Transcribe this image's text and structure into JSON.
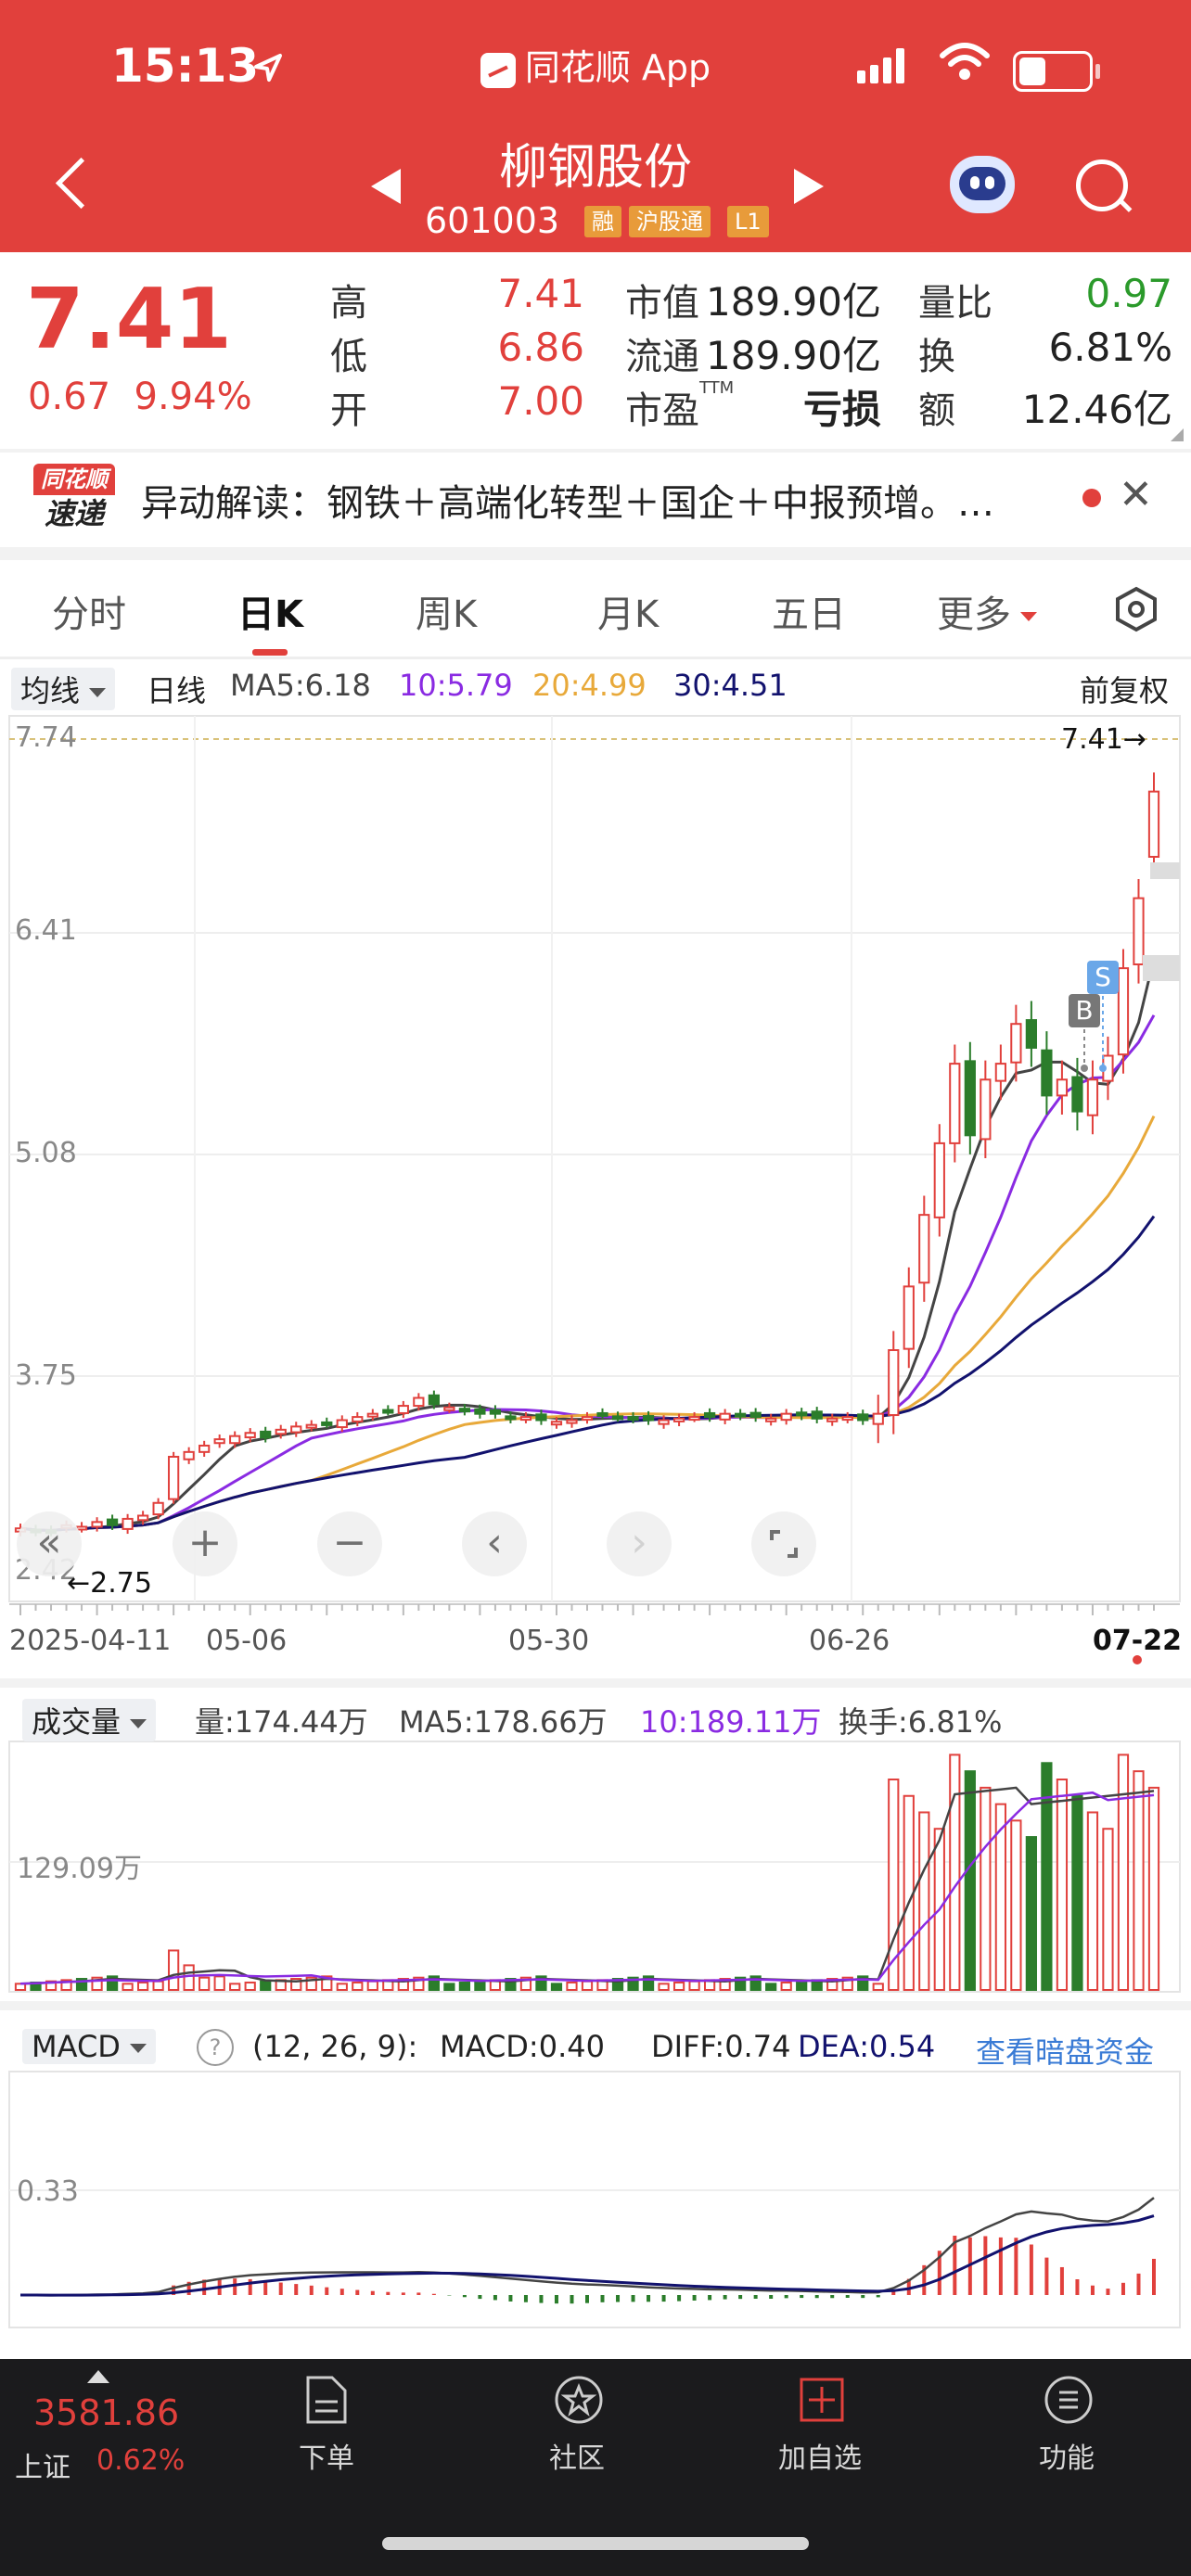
{
  "status_bar": {
    "time": "15:13",
    "app_title": "同花顺 App"
  },
  "header": {
    "stock_name": "柳钢股份",
    "stock_code": "601003",
    "tags": [
      "融",
      "沪股通",
      "L1"
    ]
  },
  "quote": {
    "price": "7.41",
    "change": "0.67",
    "change_pct": "9.94%",
    "high_label": "高",
    "high": "7.41",
    "low_label": "低",
    "low": "6.86",
    "open_label": "开",
    "open": "7.00",
    "mktcap_label": "市值",
    "mktcap": "189.90亿",
    "float_label": "流通",
    "float": "189.90亿",
    "pe_label": "市盈",
    "pe_sup": "TTM",
    "pe": "亏损",
    "volratio_label": "量比",
    "volratio": "0.97",
    "turnover_label": "换",
    "turnover": "6.81%",
    "amount_label": "额",
    "amount": "12.46亿"
  },
  "news": {
    "badge_top": "同花顺",
    "badge_bottom": "速递",
    "text": "异动解读：钢铁＋高端化转型＋国企＋中报预增。…"
  },
  "tabs": [
    "分时",
    "日K",
    "周K",
    "月K",
    "五日",
    "更多"
  ],
  "kline_header": {
    "selector": "均线",
    "period": "日线",
    "ma5": "MA5:6.18",
    "ma10": "10:5.79",
    "ma20": "20:4.99",
    "ma30": "30:4.51",
    "adjust": "前复权"
  },
  "price_axis": {
    "ticks": [
      "7.74",
      "6.41",
      "5.08",
      "3.75",
      "2.42"
    ],
    "current_marker": "7.41→",
    "low_marker": "←2.75"
  },
  "dates": [
    "2025-04-11",
    "05-06",
    "05-30",
    "06-26",
    "07-22"
  ],
  "trade_marks": {
    "buy": "B",
    "sell": "S"
  },
  "volume_header": {
    "selector": "成交量",
    "vol": "量:174.44万",
    "ma5": "MA5:178.66万",
    "ma10": "10:189.11万",
    "turnover": "换手:6.81%",
    "axis_tick": "129.09万"
  },
  "macd_header": {
    "selector": "MACD",
    "help": "?",
    "params": "(12, 26, 9):",
    "macd": "MACD:0.40",
    "diff": "DIFF:0.74",
    "dea": "DEA:0.54",
    "link": "查看暗盘资金",
    "axis_tick": "0.33"
  },
  "colors": {
    "up": "#e1403c",
    "down": "#2b7d2b",
    "ma5": "#444444",
    "ma10": "#8a2be2",
    "ma20": "#e8a93a",
    "ma30": "#12126e",
    "link": "#3a7bd5"
  },
  "bottom_nav": {
    "index_value": "3581.86",
    "index_name": "上证",
    "index_pct": "0.62%",
    "items": [
      "下单",
      "社区",
      "加自选",
      "功能"
    ]
  },
  "chart_data": {
    "type": "candlestick",
    "x_range": [
      "2025-04-11",
      "07-22"
    ],
    "ylim": [
      2.42,
      7.74
    ],
    "last": {
      "open": 7.0,
      "high": 7.41,
      "low": 6.86,
      "close": 7.41
    },
    "closes": [
      2.78,
      2.76,
      2.76,
      2.8,
      2.79,
      2.82,
      2.8,
      2.84,
      2.86,
      2.94,
      3.23,
      3.26,
      3.3,
      3.34,
      3.36,
      3.38,
      3.35,
      3.4,
      3.42,
      3.43,
      3.44,
      3.46,
      3.48,
      3.5,
      3.52,
      3.55,
      3.6,
      3.56,
      3.54,
      3.52,
      3.5,
      3.5,
      3.47,
      3.48,
      3.46,
      3.45,
      3.46,
      3.48,
      3.5,
      3.48,
      3.47,
      3.46,
      3.46,
      3.47,
      3.48,
      3.48,
      3.5,
      3.49,
      3.48,
      3.47,
      3.5,
      3.49,
      3.47,
      3.47,
      3.48,
      3.46,
      3.5,
      3.9,
      4.3,
      4.75,
      5.2,
      5.7,
      5.25,
      5.6,
      5.7,
      5.95,
      5.8,
      5.5,
      5.6,
      5.4,
      5.6,
      5.75,
      6.3,
      6.74,
      7.41
    ],
    "volume_ma_tick": 129.09,
    "macd_tick": 0.33
  }
}
